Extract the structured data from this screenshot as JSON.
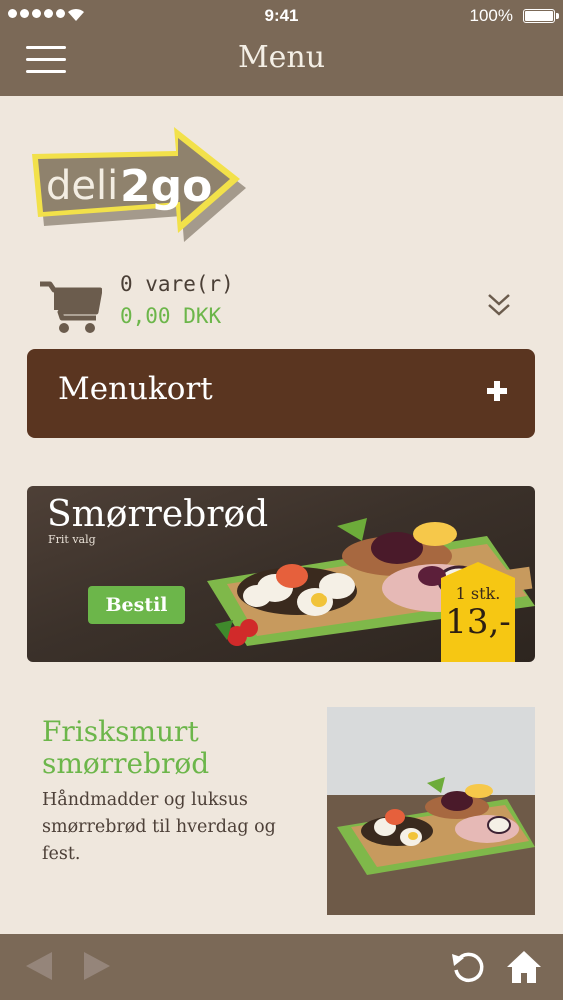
{
  "status_bar": {
    "time": "9:41",
    "battery": "100%"
  },
  "nav": {
    "title": "Menu"
  },
  "logo": {
    "text_main": "deli",
    "text_accent": "2go"
  },
  "cart": {
    "count": "0 vare(r)",
    "total": "0,00 DKK"
  },
  "menu_button": {
    "label": "Menukort"
  },
  "banner": {
    "title": "Smørrebrød",
    "subtitle": "Frit valg",
    "button": "Bestil",
    "price_qty": "1 stk.",
    "price_value": "13,-"
  },
  "info": {
    "title": "Frisksmurt smørrebrød",
    "description": "Håndmadder og luksus smørrebrød til hverdag og fest."
  },
  "colors": {
    "header": "#7b6957",
    "background": "#efe7dd",
    "accent_green": "#6cb64a",
    "menu_brown": "#5a3520",
    "price_yellow": "#f6c713"
  },
  "icons": {
    "hamburger": "menu-icon",
    "cart": "cart-icon",
    "expand": "chevron-double-down-icon",
    "plus": "plus-icon",
    "back": "arrow-left-icon",
    "forward": "arrow-right-icon",
    "refresh": "refresh-icon",
    "home": "home-icon"
  }
}
